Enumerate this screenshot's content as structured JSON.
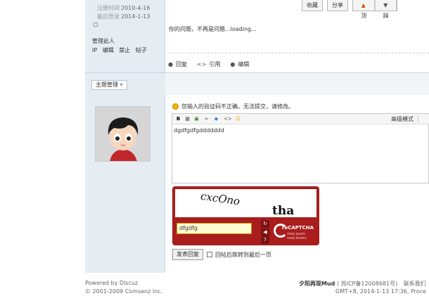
{
  "profile": {
    "register_label": "注册时间",
    "register_date": "2010-4-16",
    "last_login_label": "最后登录",
    "last_login_date": "2014-1-13",
    "manage_title": "管理此人",
    "manage_links": [
      "IP",
      "编辑",
      "禁止",
      "帖子"
    ]
  },
  "post_buttons": {
    "favorite": "收藏",
    "share": "分享",
    "up": "顶",
    "down": "踩"
  },
  "post": {
    "content": "你的问题，不再是问题...loading...",
    "actions": [
      "回复",
      "引用",
      "编辑"
    ]
  },
  "topic_manage_label": "主题管理",
  "reply_form": {
    "error_message": "您输入的验证码不正确，无法提交，请修改。",
    "advanced_mode": "高级模式",
    "editor_text": "dgdfgdfgddddddd",
    "captcha_text_1": "cxcOno",
    "captcha_text_2": "tha",
    "captcha_input_value": "dfgdfg",
    "captcha_brand": "reCAPTCHA",
    "captcha_tagline_1": "stop spam.",
    "captcha_tagline_2": "read books.",
    "submit_label": "发表回复",
    "jump_label": "回帖后跳转到最后一页"
  },
  "footer": {
    "powered": "Powered by Discuz",
    "copyright": "© 2001-2009 Comsenz Inc.",
    "site_name": "夕阳再现Mud",
    "icp": "( 苏ICP备12008681号)",
    "contact": "联系我们",
    "time_info": "GMT+8, 2014-1-13 17:36, Proce"
  },
  "colors": {
    "sidebar_bg": "#e5edf2",
    "captcha_red": "#a91d1d"
  }
}
